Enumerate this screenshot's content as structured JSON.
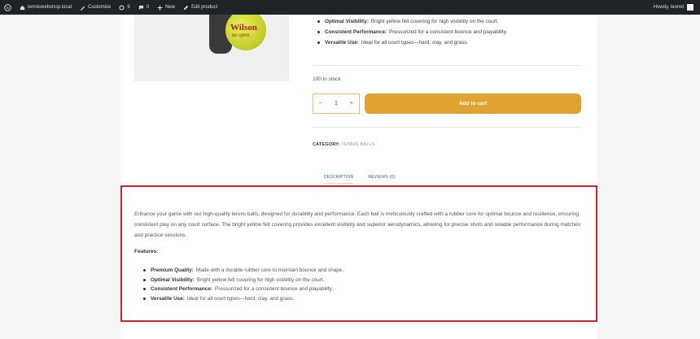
{
  "admin_bar": {
    "site_name": "tenniswebshop.local",
    "customize": "Customize",
    "updates_count": "9",
    "comments_count": "0",
    "new_label": "New",
    "edit_product": "Edit product",
    "greeting": "Howdy, leonel"
  },
  "top_features": [
    {
      "label": "Optimal Visibility:",
      "text": "Bright yellow felt covering for high visibility on the court."
    },
    {
      "label": "Consistent Performance:",
      "text": "Pressurized for a consistent bounce and playability."
    },
    {
      "label": "Versatile Use:",
      "text": "Ideal for all court types—hard, clay, and grass."
    }
  ],
  "product_image": {
    "brand_text": "Wilson",
    "sub_text": "us open"
  },
  "stock": "100 in stock",
  "quantity": {
    "minus": "−",
    "value": "1",
    "plus": "+"
  },
  "add_to_cart": "Add to cart",
  "category": {
    "label": "CATEGORY:",
    "value": "TENNIS BALLS"
  },
  "tabs": {
    "description": "DESCRIPTION",
    "reviews": "REVIEWS (0)"
  },
  "description": {
    "text": "Enhance your game with our high-quality tennis balls, designed for durability and performance. Each ball is meticulously crafted with a rubber core for optimal bounce and resilience, ensuring consistent play on any court surface. The bright yellow felt covering provides excellent visibility and superior aerodynamics, allowing for precise shots and reliable performance during matches and practice sessions.",
    "features_heading": "Features:",
    "features": [
      {
        "label": "Premium Quality:",
        "text": "Made with a durable rubber core to maintain bounce and shape."
      },
      {
        "label": "Optimal Visibility:",
        "text": "Bright yellow felt covering for high visibility on the court."
      },
      {
        "label": "Consistent Performance:",
        "text": "Pressurized for a consistent bounce and playability."
      },
      {
        "label": "Versatile Use:",
        "text": "Ideal for all court types—hard, clay, and grass."
      }
    ]
  },
  "colors": {
    "accent": "#e0a32f",
    "highlight": "#d1242f",
    "admin_bar": "#1d2327",
    "link": "#1f5ea8"
  }
}
